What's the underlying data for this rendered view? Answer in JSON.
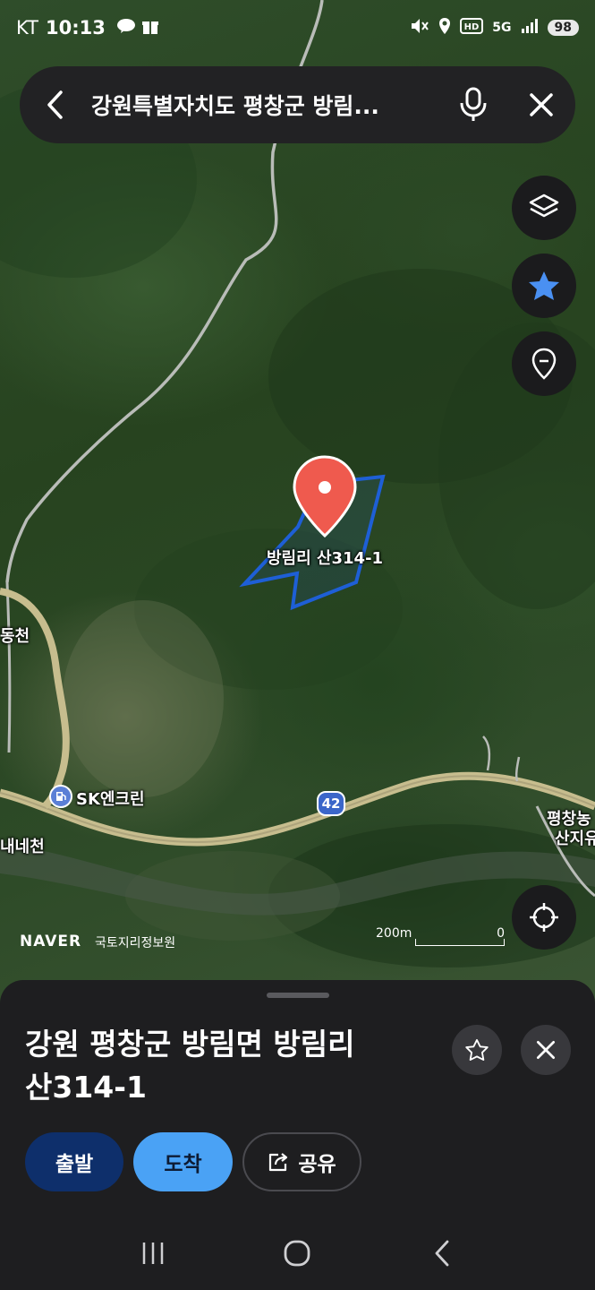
{
  "status_bar": {
    "carrier": "KT",
    "time": "10:13",
    "network": "5G",
    "battery": "98"
  },
  "search": {
    "query": "강원특별자치도 평창군 방림..."
  },
  "map": {
    "marker_label": "방림리 산314-1",
    "labels": {
      "dongcheon": "동천",
      "gas_station": "SK엔크린",
      "naecheon": "내네천",
      "pyeongchang_top": "평창농",
      "pyeongchang_bottom": "산지유"
    },
    "route_number": "42",
    "brand": "NAVER",
    "attribution": "국토지리정보원",
    "scale_label": "200m",
    "scale_zero": "0",
    "boundary_color": "#1e5fd6",
    "marker_color": "#ef5a4e"
  },
  "place": {
    "address_line1": "강원 평창군 방림면 방림리",
    "address_line2": "산314-1"
  },
  "actions": {
    "depart": "출발",
    "arrive": "도착",
    "share": "공유"
  }
}
